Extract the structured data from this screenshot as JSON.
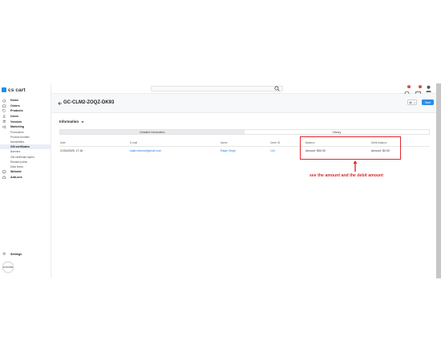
{
  "app": {
    "logo_text": "cs cart"
  },
  "search": {
    "placeholder": "Search"
  },
  "notifications": [
    {
      "count": "1"
    },
    {
      "count": "1"
    }
  ],
  "sidebar": {
    "items": [
      {
        "label": "Home",
        "icon": "home-icon"
      },
      {
        "label": "Orders",
        "icon": "orders-icon"
      },
      {
        "label": "Products",
        "icon": "tag-icon"
      },
      {
        "label": "Users",
        "icon": "user-icon"
      },
      {
        "label": "Vendors",
        "icon": "vendors-icon"
      },
      {
        "label": "Marketing",
        "icon": "megaphone-icon"
      }
    ],
    "marketing_sub": [
      "Promotions",
      "Product bundles",
      "Newsletters",
      "Gift certificates",
      "Banners",
      "Gift certificate layers",
      "Reward points",
      "Data feeds"
    ],
    "items_after": [
      {
        "label": "Website",
        "icon": "monitor-icon"
      },
      {
        "label": "Add-ons",
        "icon": "puzzle-icon"
      }
    ],
    "settings_label": "Settings",
    "avatar_label": "ATTACHED"
  },
  "page": {
    "title": "GC-CLM2-ZOQZ-DK93",
    "save_label": "Save"
  },
  "section": {
    "title": "Information"
  },
  "tabs": [
    {
      "label": "Detailed information"
    },
    {
      "label": "History"
    }
  ],
  "table": {
    "headers": {
      "date": "Date",
      "email": "E-mail",
      "name": "Name",
      "order_id": "Order ID",
      "balance": "Balance",
      "debit_balance": "Debit balance"
    },
    "row": {
      "date": "21/04/2025, 17:16",
      "email": "kajal.sharma@gmail.com",
      "name": "Rajan Singh",
      "order_id": "144",
      "balance": "Amount: $50.00",
      "debit_balance": "Amount: $0.00"
    }
  },
  "annotation": {
    "text": "see the amount and the debit amount"
  },
  "colors": {
    "accent": "#2a8ee8",
    "annotation": "#e0282c"
  }
}
